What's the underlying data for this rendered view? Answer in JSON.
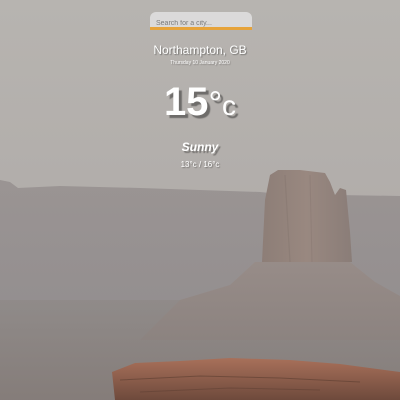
{
  "search": {
    "placeholder": "Search for a city..."
  },
  "weather": {
    "location": "Northampton, GB",
    "date": "Thursday 10 January 2020",
    "temperature": "15",
    "degree_symbol": "°",
    "unit": "c",
    "condition": "Sunny",
    "range": "13°c / 16°c"
  },
  "colors": {
    "search_underline": "#e6a33a",
    "text": "#ffffff"
  },
  "icons": {
    "background": "desert-butte-landscape"
  }
}
